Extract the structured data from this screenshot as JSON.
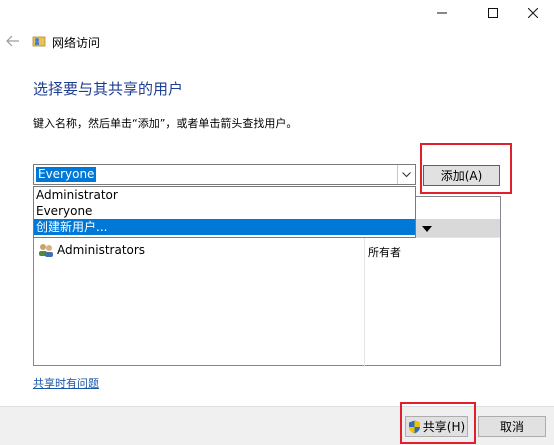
{
  "window": {
    "controls": [
      "minimize-icon",
      "maximize-icon",
      "close-icon"
    ]
  },
  "header": {
    "title": "网络访问",
    "icon": "network-folder-icon"
  },
  "main": {
    "heading": "选择要与其共享的用户",
    "instruction": "键入名称，然后单击“添加”，或者单击箭头查找用户。",
    "combo_value": "Everyone",
    "dropdown_options": [
      "Administrator",
      "Everyone",
      "创建新用户..."
    ],
    "selected_option": "创建新用户...",
    "add_label": "添加(A)",
    "list_rows": [
      {
        "name": "Administrators",
        "level": "所有者"
      }
    ],
    "help_link": "共享时有问题"
  },
  "footer": {
    "share_label": "共享(H)",
    "cancel_label": "取消"
  },
  "colors": {
    "heading": "#1e3e93",
    "selection": "#0078d7",
    "highlight_box": "#e0212d",
    "link": "#1a56a8"
  }
}
